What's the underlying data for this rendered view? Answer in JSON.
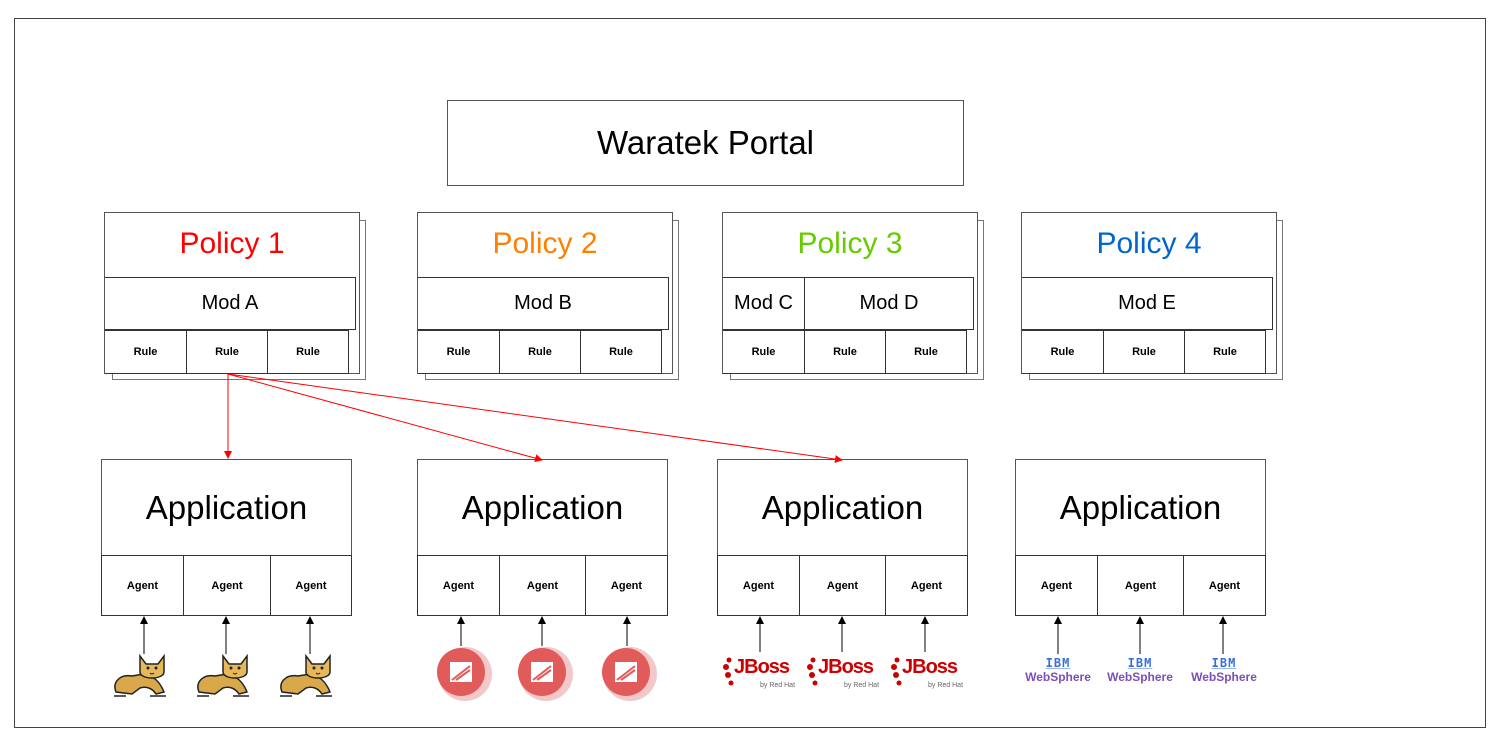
{
  "portal": {
    "label": "Waratek Portal"
  },
  "policies": [
    {
      "title": "Policy 1",
      "color": "#ff0000",
      "mods": [
        {
          "label": "Mod A",
          "rules": [
            "Rule",
            "Rule",
            "Rule"
          ]
        }
      ]
    },
    {
      "title": "Policy 2",
      "color": "#ff8000",
      "mods": [
        {
          "label": "Mod B",
          "rules": [
            "Rule",
            "Rule",
            "Rule"
          ]
        }
      ]
    },
    {
      "title": "Policy 3",
      "color": "#66cc00",
      "mods": [
        {
          "label": "Mod C",
          "rules": [
            "Rule"
          ]
        },
        {
          "label": "Mod D",
          "rules": [
            "Rule",
            "Rule"
          ]
        }
      ]
    },
    {
      "title": "Policy 4",
      "color": "#0066cc",
      "mods": [
        {
          "label": "Mod E",
          "rules": [
            "Rule",
            "Rule",
            "Rule"
          ]
        }
      ]
    }
  ],
  "applications": [
    {
      "title": "Application",
      "agents": [
        "Agent",
        "Agent",
        "Agent"
      ],
      "server_icon": "tomcat-icon"
    },
    {
      "title": "Application",
      "agents": [
        "Agent",
        "Agent",
        "Agent"
      ],
      "server_icon": "openliberty-icon"
    },
    {
      "title": "Application",
      "agents": [
        "Agent",
        "Agent",
        "Agent"
      ],
      "server_icon": "jboss-icon"
    },
    {
      "title": "Application",
      "agents": [
        "Agent",
        "Agent",
        "Agent"
      ],
      "server_icon": "websphere-icon"
    }
  ],
  "logos": {
    "jboss": {
      "text": "JBoss",
      "sub": "by Red Hat"
    },
    "websphere": {
      "ibm": "IBM",
      "name": "WebSphere"
    }
  },
  "colors": {
    "arrow_red": "#ff0000",
    "arrow_black": "#000000"
  }
}
